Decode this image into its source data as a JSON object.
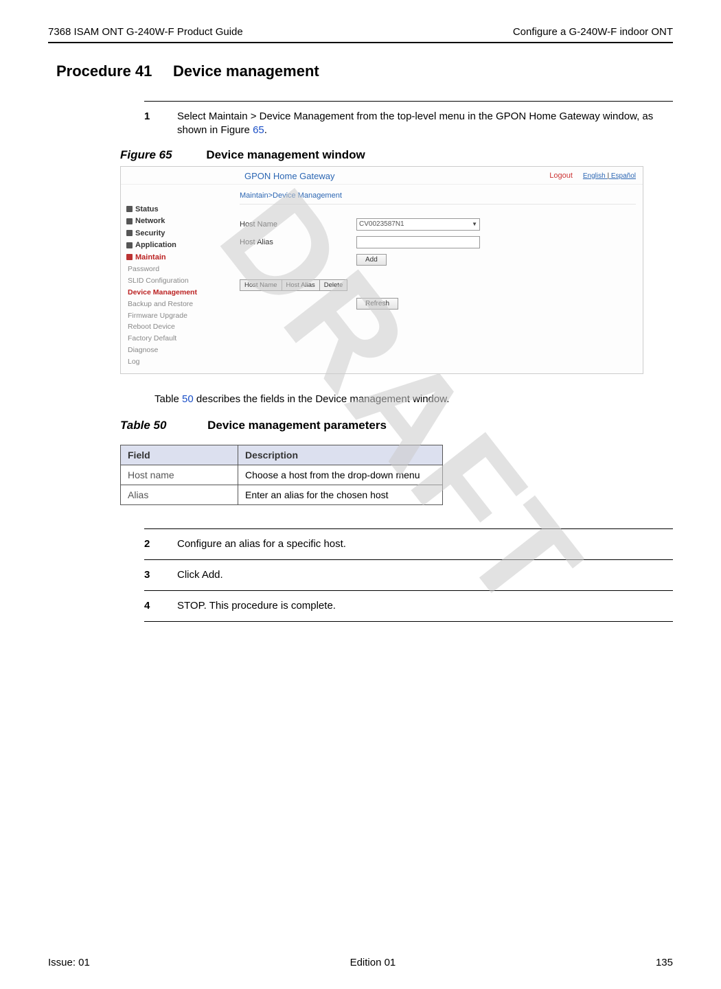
{
  "header": {
    "left": "7368 ISAM ONT G-240W-F Product Guide",
    "right": "Configure a G-240W-F indoor ONT"
  },
  "procedure": {
    "label": "Procedure 41",
    "title": "Device management"
  },
  "steps": {
    "s1": {
      "num": "1",
      "text_a": "Select Maintain > Device Management from the top-level menu in the GPON Home Gateway window, as shown in Figure ",
      "link": "65",
      "text_b": "."
    },
    "s2": {
      "num": "2",
      "text": "Configure an alias for a specific host."
    },
    "s3": {
      "num": "3",
      "text": "Click Add."
    },
    "s4": {
      "num": "4",
      "text": "STOP. This procedure is complete."
    }
  },
  "figure": {
    "label": "Figure 65",
    "title": "Device management window"
  },
  "screenshot": {
    "app_title": "GPON Home Gateway",
    "logout": "Logout",
    "lang_en": "English",
    "lang_sep": " | ",
    "lang_es": "Español",
    "breadcrumb": "Maintain>Device Management",
    "sidebar": {
      "items": [
        "Status",
        "Network",
        "Security",
        "Application",
        "Maintain"
      ],
      "sub": [
        "Password",
        "SLID Configuration",
        "Device Management",
        "Backup and Restore",
        "Firmware Upgrade",
        "Reboot Device",
        "Factory Default",
        "Diagnose",
        "Log"
      ]
    },
    "form": {
      "host_name_label": "Host Name",
      "host_name_value": "CV0023587N1",
      "host_alias_label": "Host Alias",
      "add_btn": "Add",
      "refresh_btn": "Refresh"
    },
    "minitable": {
      "c1": "Host Name",
      "c2": "Host Alias",
      "c3": "Delete"
    }
  },
  "table_desc": {
    "pre": "Table ",
    "link": "50",
    "post": " describes the fields in the Device management window."
  },
  "table": {
    "label": "Table 50",
    "title": "Device management parameters",
    "header": {
      "field": "Field",
      "desc": "Description"
    },
    "rows": [
      {
        "field": "Host name",
        "desc": "Choose a host from the drop-down menu"
      },
      {
        "field": "Alias",
        "desc": "Enter an alias for the chosen host"
      }
    ]
  },
  "watermark": "DRAFT",
  "footer": {
    "left": "Issue: 01",
    "center": "Edition 01",
    "right": "135"
  }
}
